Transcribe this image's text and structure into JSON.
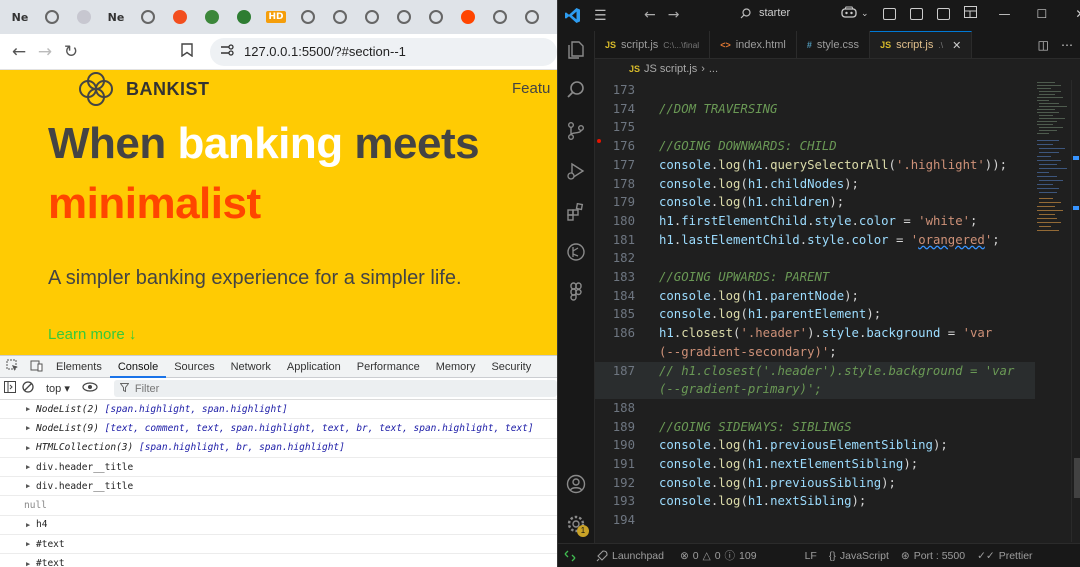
{
  "browser": {
    "tabs": [
      {
        "label": "Ne",
        "icon": "notion-icon"
      },
      {
        "label": "",
        "icon": "globe-icon"
      },
      {
        "label": "",
        "icon": "pinwheel-icon"
      },
      {
        "label": "Ne",
        "icon": "notion-icon"
      },
      {
        "label": "",
        "icon": "globe-icon"
      },
      {
        "label": "",
        "icon": "figma-icon"
      },
      {
        "label": "",
        "icon": "node-icon"
      },
      {
        "label": "",
        "icon": "infinity-icon"
      },
      {
        "label": "HD",
        "icon": "hd-icon"
      },
      {
        "label": "",
        "icon": "globe-icon"
      },
      {
        "label": "",
        "icon": "globe-icon"
      },
      {
        "label": "",
        "icon": "globe-icon"
      },
      {
        "label": "",
        "icon": "globe-icon"
      },
      {
        "label": "",
        "icon": "globe-icon"
      },
      {
        "label": "",
        "icon": "reddit-icon"
      },
      {
        "label": "",
        "icon": "globe-icon"
      },
      {
        "label": "",
        "icon": "globe-icon"
      }
    ],
    "url": "127.0.0.1:5500/?#section--1",
    "site": {
      "logo_text": "BANKIST",
      "nav_partial": "Featu",
      "hero_part1": "When ",
      "hero_part2": "banking",
      "hero_part3": " meets",
      "hero_line2": "minimalist",
      "subtitle": "A simpler banking experience for a simpler life.",
      "learn_more": "Learn more ↓"
    },
    "devtools": {
      "tabs": [
        "Elements",
        "Console",
        "Sources",
        "Network",
        "Application",
        "Performance",
        "Memory",
        "Security"
      ],
      "active_tab": "Console",
      "context": "top ▾",
      "filter_placeholder": "Filter",
      "console_rows": [
        {
          "head": "NodeList(2)",
          "body": "[span.highlight, span.highlight]"
        },
        {
          "head": "NodeList(9)",
          "body": "[text, comment, text, span.highlight, text, br, text, span.highlight, text]"
        },
        {
          "head": "HTMLCollection(3)",
          "body": "[span.highlight, br, span.highlight]"
        },
        {
          "head": "div.header__title",
          "body": ""
        },
        {
          "head": "div.header__title",
          "body": ""
        },
        {
          "head": "null",
          "body": ""
        },
        {
          "head": "h4",
          "body": ""
        },
        {
          "head": "#text",
          "body": ""
        },
        {
          "head": "#text",
          "body": ""
        }
      ]
    }
  },
  "vscode": {
    "command_center": "starter",
    "tabs": [
      {
        "lang": "JS",
        "name": "script.js",
        "path": "C:\\...\\final",
        "active": false
      },
      {
        "lang": "<>",
        "name": "index.html",
        "path": "",
        "active": false
      },
      {
        "lang": "#",
        "name": "style.css",
        "path": "",
        "active": false
      },
      {
        "lang": "JS",
        "name": "script.js",
        "path": ".\\",
        "active": true
      }
    ],
    "breadcrumb": [
      "JS script.js",
      "›",
      "..."
    ],
    "code_lines": [
      {
        "n": "173",
        "t": ""
      },
      {
        "n": "174",
        "t": "//DOM TRAVERSING"
      },
      {
        "n": "175",
        "t": ""
      },
      {
        "n": "176",
        "t": "//GOING DOWNWARDS: CHILD"
      },
      {
        "n": "177",
        "t": "console.log(h1.querySelectorAll('.highlight'));"
      },
      {
        "n": "178",
        "t": "console.log(h1.childNodes);"
      },
      {
        "n": "179",
        "t": "console.log(h1.children);"
      },
      {
        "n": "180",
        "t": "h1.firstElementChild.style.color = 'white';"
      },
      {
        "n": "181",
        "t": "h1.lastElementChild.style.color = 'orangered';"
      },
      {
        "n": "182",
        "t": ""
      },
      {
        "n": "183",
        "t": "//GOING UPWARDS: PARENT"
      },
      {
        "n": "184",
        "t": "console.log(h1.parentNode);"
      },
      {
        "n": "185",
        "t": "console.log(h1.parentElement);"
      },
      {
        "n": "186",
        "t": "h1.closest('.header').style.background = 'var"
      },
      {
        "n": "",
        "t": "(--gradient-secondary)';"
      },
      {
        "n": "187",
        "t": "// h1.closest('.header').style.background = 'var"
      },
      {
        "n": "",
        "t": "(--gradient-primary)';"
      },
      {
        "n": "188",
        "t": ""
      },
      {
        "n": "189",
        "t": "//GOING SIDEWAYS: SIBLINGS"
      },
      {
        "n": "190",
        "t": "console.log(h1.previousElementSibling);"
      },
      {
        "n": "191",
        "t": "console.log(h1.nextElementSibling);"
      },
      {
        "n": "192",
        "t": "console.log(h1.previousSibling);"
      },
      {
        "n": "193",
        "t": "console.log(h1.nextSibling);"
      },
      {
        "n": "194",
        "t": ""
      }
    ],
    "status": {
      "launchpad": "Launchpad",
      "errors": "0",
      "warnings": "0",
      "info": "109",
      "eol": "LF",
      "language": "JavaScript",
      "port": "Port : 5500",
      "prettier": "Prettier",
      "accounts_badge": "1"
    }
  }
}
